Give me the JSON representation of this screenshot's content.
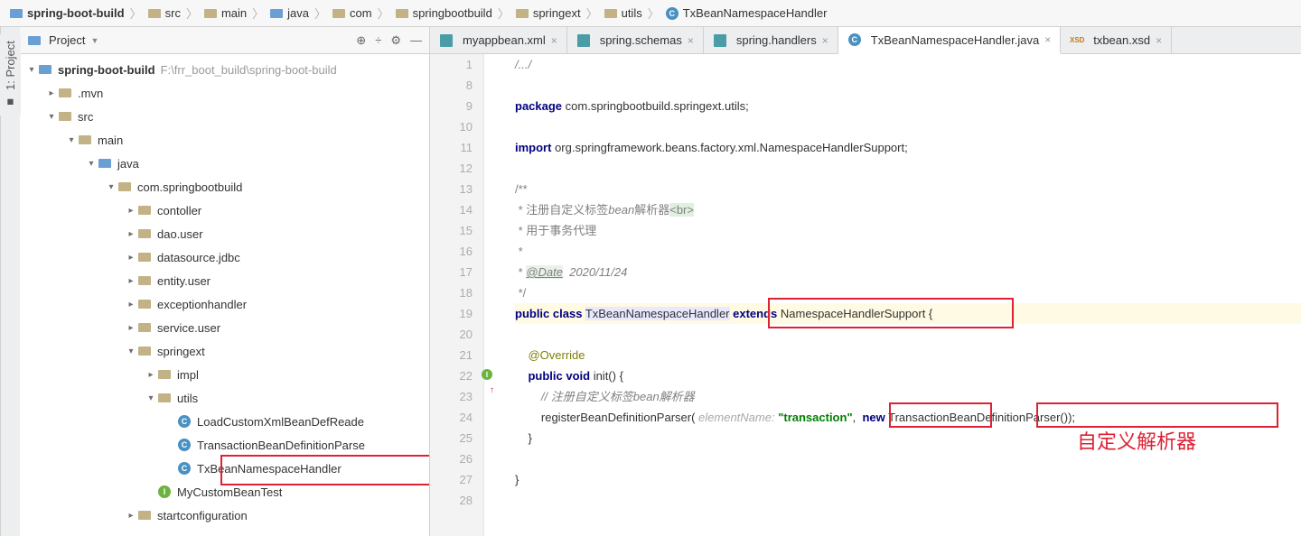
{
  "breadcrumb": [
    {
      "label": "spring-boot-build",
      "icon": "folder-blue",
      "bold": true
    },
    {
      "label": "src",
      "icon": "folder"
    },
    {
      "label": "main",
      "icon": "folder"
    },
    {
      "label": "java",
      "icon": "folder-blue"
    },
    {
      "label": "com",
      "icon": "folder"
    },
    {
      "label": "springbootbuild",
      "icon": "folder"
    },
    {
      "label": "springext",
      "icon": "folder"
    },
    {
      "label": "utils",
      "icon": "folder"
    },
    {
      "label": "TxBeanNamespaceHandler",
      "icon": "class"
    }
  ],
  "left_tab": "1: Project",
  "project_panel": {
    "title": "Project",
    "root_path": "F:\\frr_boot_build\\spring-boot-build"
  },
  "tree": [
    {
      "depth": 0,
      "arrow": "down",
      "icon": "folder-blue",
      "label": "spring-boot-build",
      "bold": true,
      "path": "F:\\frr_boot_build\\spring-boot-build"
    },
    {
      "depth": 1,
      "arrow": "right",
      "icon": "folder",
      "label": ".mvn"
    },
    {
      "depth": 1,
      "arrow": "down",
      "icon": "folder",
      "label": "src"
    },
    {
      "depth": 2,
      "arrow": "down",
      "icon": "folder",
      "label": "main"
    },
    {
      "depth": 3,
      "arrow": "down",
      "icon": "folder-blue",
      "label": "java"
    },
    {
      "depth": 4,
      "arrow": "down",
      "icon": "folder",
      "label": "com.springbootbuild"
    },
    {
      "depth": 5,
      "arrow": "right",
      "icon": "folder",
      "label": "contoller"
    },
    {
      "depth": 5,
      "arrow": "right",
      "icon": "folder",
      "label": "dao.user"
    },
    {
      "depth": 5,
      "arrow": "right",
      "icon": "folder",
      "label": "datasource.jdbc"
    },
    {
      "depth": 5,
      "arrow": "right",
      "icon": "folder",
      "label": "entity.user"
    },
    {
      "depth": 5,
      "arrow": "right",
      "icon": "folder",
      "label": "exceptionhandler"
    },
    {
      "depth": 5,
      "arrow": "right",
      "icon": "folder",
      "label": "service.user"
    },
    {
      "depth": 5,
      "arrow": "down",
      "icon": "folder",
      "label": "springext"
    },
    {
      "depth": 6,
      "arrow": "right",
      "icon": "folder",
      "label": "impl"
    },
    {
      "depth": 6,
      "arrow": "down",
      "icon": "folder",
      "label": "utils"
    },
    {
      "depth": 7,
      "arrow": "none",
      "icon": "class",
      "label": "LoadCustomXmlBeanDefReade"
    },
    {
      "depth": 7,
      "arrow": "none",
      "icon": "class",
      "label": "TransactionBeanDefinitionParse"
    },
    {
      "depth": 7,
      "arrow": "none",
      "icon": "class",
      "label": "TxBeanNamespaceHandler",
      "highlighted": true
    },
    {
      "depth": 6,
      "arrow": "none",
      "icon": "iface",
      "label": "MyCustomBeanTest"
    },
    {
      "depth": 5,
      "arrow": "right",
      "icon": "folder",
      "label": "startconfiguration"
    }
  ],
  "tabs": [
    {
      "label": "myappbean.xml",
      "icon": "xml"
    },
    {
      "label": "spring.schemas",
      "icon": "cfg"
    },
    {
      "label": "spring.handlers",
      "icon": "cfg"
    },
    {
      "label": "TxBeanNamespaceHandler.java",
      "icon": "class",
      "active": true
    },
    {
      "label": "txbean.xsd",
      "icon": "xsd"
    }
  ],
  "code": {
    "lines": [
      {
        "n": 1,
        "html": "<span class='comment'>/.../</span>"
      },
      {
        "n": 8,
        "html": ""
      },
      {
        "n": 9,
        "html": "<span class='kw'>package</span> com.springbootbuild.springext.utils;"
      },
      {
        "n": 10,
        "html": ""
      },
      {
        "n": 11,
        "html": "<span class='kw'>import</span> org.springframework.beans.factory.xml.NamespaceHandlerSupport;"
      },
      {
        "n": 12,
        "html": ""
      },
      {
        "n": 13,
        "html": "<span class='doccomment'>/**</span>"
      },
      {
        "n": 14,
        "html": "<span class='doccomment'> * 注册自定义标签<i>bean</i>解析器</span><span class='doc-br'>&lt;br&gt;</span>"
      },
      {
        "n": 15,
        "html": "<span class='doccomment'> * 用于事务代理</span>"
      },
      {
        "n": 16,
        "html": "<span class='doccomment'> *</span>"
      },
      {
        "n": 17,
        "html": "<span class='doccomment'> * <span class='doc-tag'>@Date</span>  <i>2020/11/24</i></span>"
      },
      {
        "n": 18,
        "html": "<span class='doccomment'> */</span>"
      },
      {
        "n": 19,
        "html": "<span class='kw'>public class</span> <span class='cls-name'>TxBeanNamespaceHandler</span> <span class='kw'>extends</span> NamespaceHandlerSupport {",
        "current": true
      },
      {
        "n": 20,
        "html": ""
      },
      {
        "n": 21,
        "html": "    <span class='anno'>@Override</span>"
      },
      {
        "n": 22,
        "html": "    <span class='kw'>public void</span> init() {",
        "gutter_mark": "impl"
      },
      {
        "n": 23,
        "html": "        <span class='comment'>// 注册自定义标签<i>bean</i>解析器</span>"
      },
      {
        "n": 24,
        "html": "        registerBeanDefinitionParser( <span class='hint'>elementName:</span> <span class='str'>\"transaction\"</span>,  <span class='kw'>new</span> TransactionBeanDefinitionParser());"
      },
      {
        "n": 25,
        "html": "    }"
      },
      {
        "n": 26,
        "html": ""
      },
      {
        "n": 27,
        "html": "}"
      },
      {
        "n": 28,
        "html": ""
      }
    ]
  },
  "annotations": {
    "red_label": "自定义解析器"
  }
}
